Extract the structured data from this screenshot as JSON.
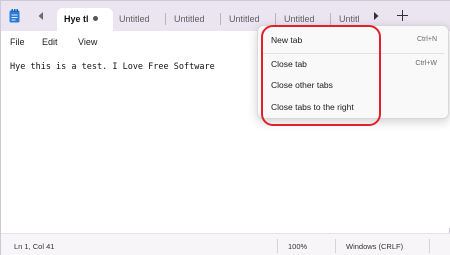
{
  "tabs": [
    {
      "label": "Hye tl",
      "active": true,
      "modified": true
    },
    {
      "label": "Untitled"
    },
    {
      "label": "Untitled"
    },
    {
      "label": "Untitled"
    },
    {
      "label": "Untitled"
    },
    {
      "label": "Untitl"
    }
  ],
  "menu": {
    "file": "File",
    "edit": "Edit",
    "view": "View"
  },
  "editor": {
    "content": "Hye this is a test. I Love Free Software"
  },
  "status": {
    "position": "Ln 1, Col 41",
    "zoom": "100%",
    "line_ending": "Windows (CRLF)"
  },
  "context_menu": {
    "items": [
      {
        "label": "New tab",
        "shortcut": "Ctrl+N"
      },
      {
        "label": "Close tab",
        "shortcut": "Ctrl+W"
      },
      {
        "label": "Close other tabs",
        "shortcut": ""
      },
      {
        "label": "Close tabs to the right",
        "shortcut": ""
      }
    ]
  },
  "colors": {
    "tabstrip_bg": "#ebe4f1",
    "highlight": "#e0202a",
    "app_icon": "#2b7bd6"
  },
  "icons": {
    "app": "notepad-icon",
    "scroll_left": "chevron-left-icon",
    "scroll_right": "chevron-right-icon",
    "new_tab": "plus-icon"
  }
}
